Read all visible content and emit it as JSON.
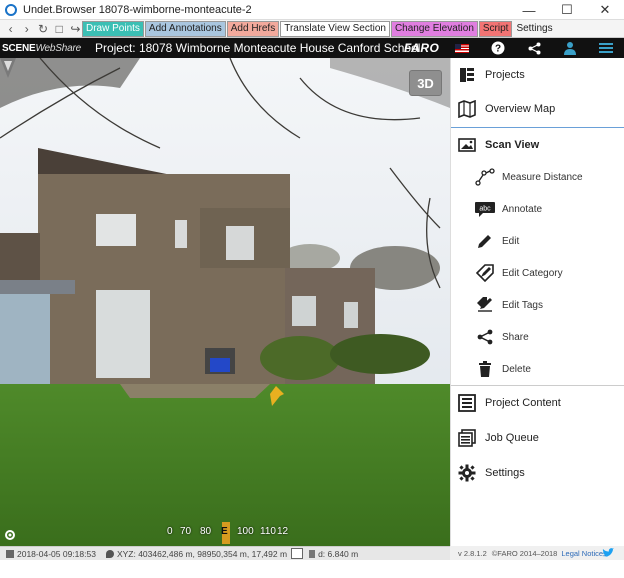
{
  "window": {
    "title": "Undet.Browser 18078-wimborne-monteacute-2",
    "controls": [
      "minimize",
      "maximize",
      "close"
    ]
  },
  "toolbar": {
    "nav_icons": [
      "back-icon",
      "forward-icon",
      "refresh-icon",
      "home-icon",
      "exit-icon"
    ],
    "buttons": [
      {
        "label": "Draw Points",
        "bg": "#3bbfb4",
        "fg": "#ffffff"
      },
      {
        "label": "Add Annotations",
        "bg": "#a9c6df",
        "fg": "#222222"
      },
      {
        "label": "Add Hrefs",
        "bg": "#f2a99c",
        "fg": "#222222"
      },
      {
        "label": "Translate View Section",
        "bg": "#ffffff",
        "fg": "#222222"
      },
      {
        "label": "Change Elevation",
        "bg": "#e07ee0",
        "fg": "#222222"
      },
      {
        "label": "Script",
        "bg": "#f27474",
        "fg": "#222222"
      },
      {
        "label": "Settings",
        "bg": "#f4f4f4",
        "fg": "#222222"
      }
    ]
  },
  "header": {
    "brand_a": "SCENE",
    "brand_b": "WebShare",
    "project": "Project: 18078 Wimborne Monteacute House Canford School",
    "logo": "FARO",
    "icons": [
      "flag-us-icon",
      "help-icon",
      "share-icon",
      "user-icon",
      "menu-icon"
    ]
  },
  "viewport": {
    "view_mode": "3D",
    "compass_ticks": [
      "0",
      "70",
      "80",
      "E",
      "100",
      "110",
      "12"
    ]
  },
  "sidebar": {
    "main_items": [
      {
        "label": "Projects",
        "icon": "projects-icon"
      },
      {
        "label": "Overview Map",
        "icon": "map-icon"
      },
      {
        "label": "Scan View",
        "icon": "scan-view-icon"
      }
    ],
    "sub_items": [
      {
        "label": "Measure Distance",
        "icon": "measure-icon"
      },
      {
        "label": "Annotate",
        "icon": "annotate-icon"
      },
      {
        "label": "Edit",
        "icon": "pencil-icon"
      },
      {
        "label": "Edit Category",
        "icon": "edit-category-icon"
      },
      {
        "label": "Edit Tags",
        "icon": "edit-tags-icon"
      },
      {
        "label": "Share",
        "icon": "share-icon"
      },
      {
        "label": "Delete",
        "icon": "trash-icon"
      }
    ],
    "bottom_items": [
      {
        "label": "Project Content",
        "icon": "project-content-icon"
      },
      {
        "label": "Job Queue",
        "icon": "job-queue-icon"
      },
      {
        "label": "Settings",
        "icon": "gear-icon"
      }
    ]
  },
  "status": {
    "datetime": "2018-04-05 09:18:53",
    "xyz": "XYZ: 403462,486 m, 98950,354 m, 17,492 m",
    "distance": "d: 6.840 m"
  },
  "footer": {
    "version": "v 2.8.1.2",
    "copyright": "©FARO 2014–2018",
    "legal": "Legal Notices"
  }
}
